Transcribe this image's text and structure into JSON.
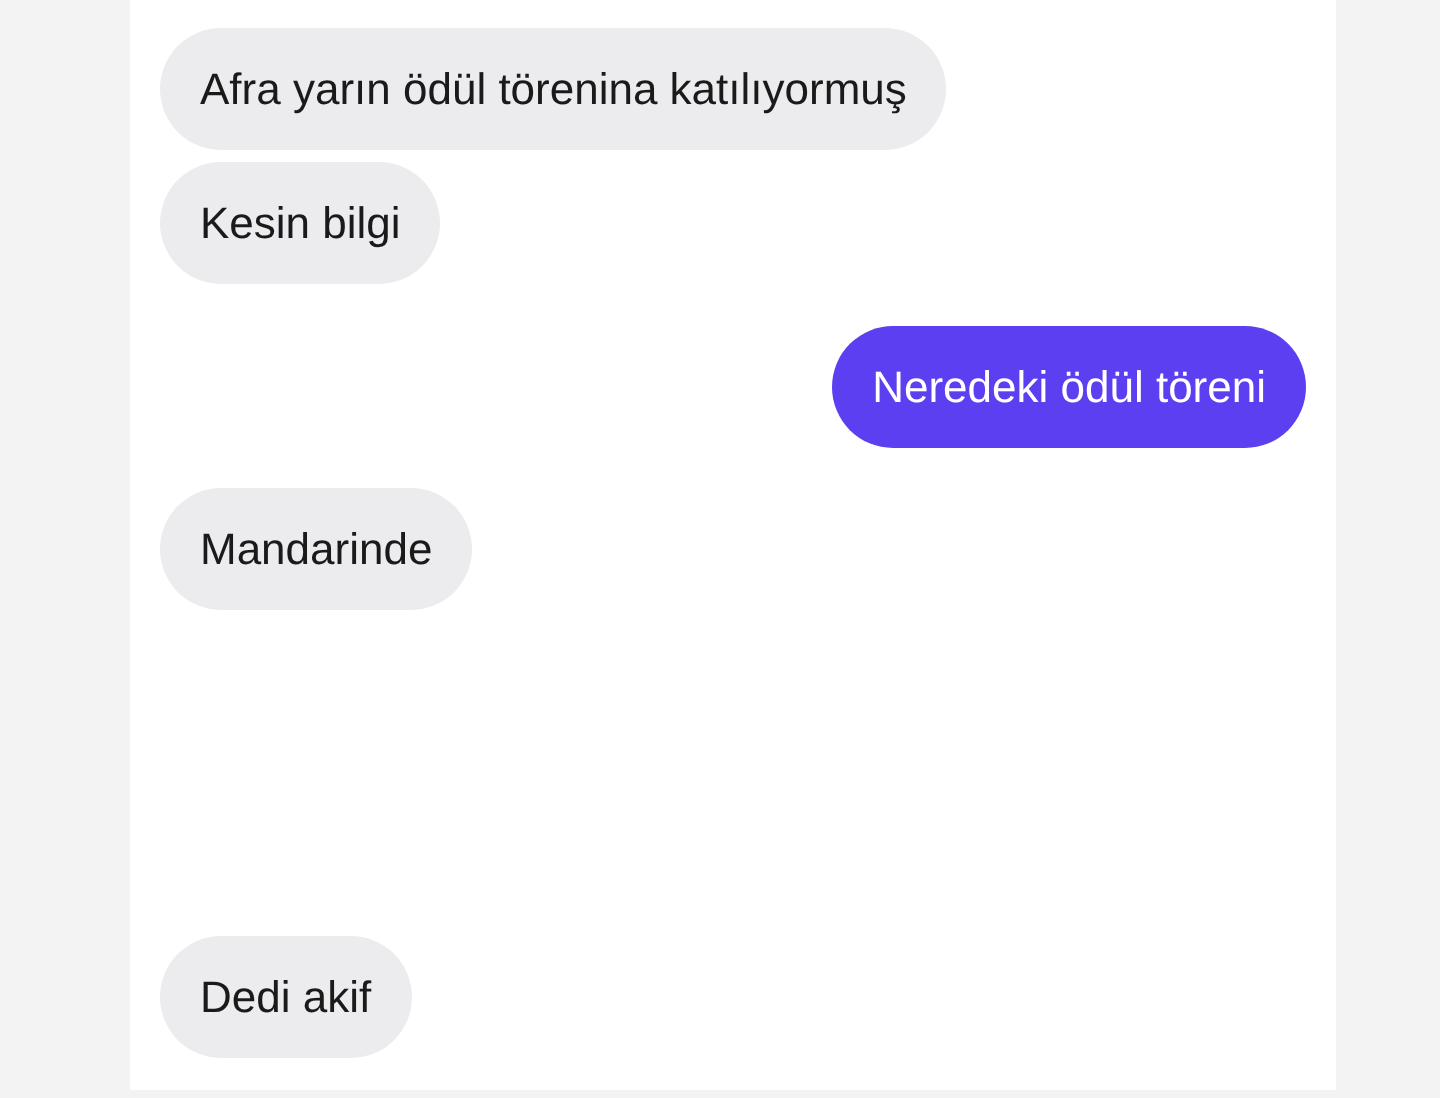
{
  "messages": [
    {
      "kind": "received",
      "text": "Afra yarın ödül törenina katılıyormuş"
    },
    {
      "kind": "received",
      "text": "Kesin bilgi"
    },
    {
      "kind": "sent",
      "text": "Neredeki ödül töreni"
    },
    {
      "kind": "received",
      "text": "Mandarinde"
    },
    {
      "kind": "received",
      "text": "Dedi akif"
    }
  ]
}
